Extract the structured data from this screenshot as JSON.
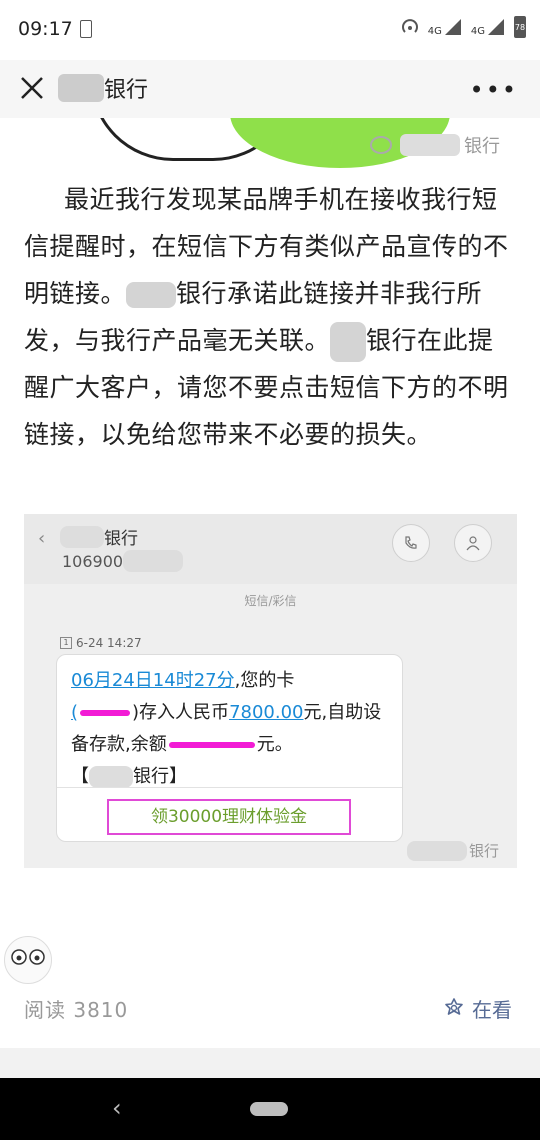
{
  "status_bar": {
    "time": "09:17",
    "net1": "4G",
    "net2": "4G",
    "battery": "78"
  },
  "title_bar": {
    "title_suffix": "银行",
    "more": "•••"
  },
  "top_image": {
    "watermark_suffix": "银行"
  },
  "article": {
    "line1": "最近我行发现某品牌手机在接收我行短信提醒时，在短信下方有类似产品宣传的不明链接。",
    "line2": "银行承诺此链接并非我行所发，与我行产品毫无关联。",
    "line3": "银行在此提醒广大客户，请您不要点击短信下方的不明链接，以免给您带来不必要的损失。"
  },
  "sms_screenshot": {
    "sender_suffix": "银行",
    "number_prefix": "106900",
    "category": "短信/彩信",
    "timestamp": "6-24 14:27",
    "msg_date": "06月24日14时27分",
    "msg_part1": ",您的卡",
    "msg_part2": ")存入人民币",
    "amount": "7800.00",
    "msg_part3": "元,自助设备存款,余额",
    "msg_part4": "元。",
    "sign_open": "【",
    "sign_close": "银行】",
    "promo": "领30000理财体验金",
    "watermark_suffix": "银行"
  },
  "footer": {
    "reads_label": "阅读",
    "reads_count": "3810",
    "like_label": "在看"
  },
  "colors": {
    "link": "#1a8ad6",
    "mask": "#f21bd5",
    "promo_border": "#e04ad6",
    "like": "#576b95"
  }
}
